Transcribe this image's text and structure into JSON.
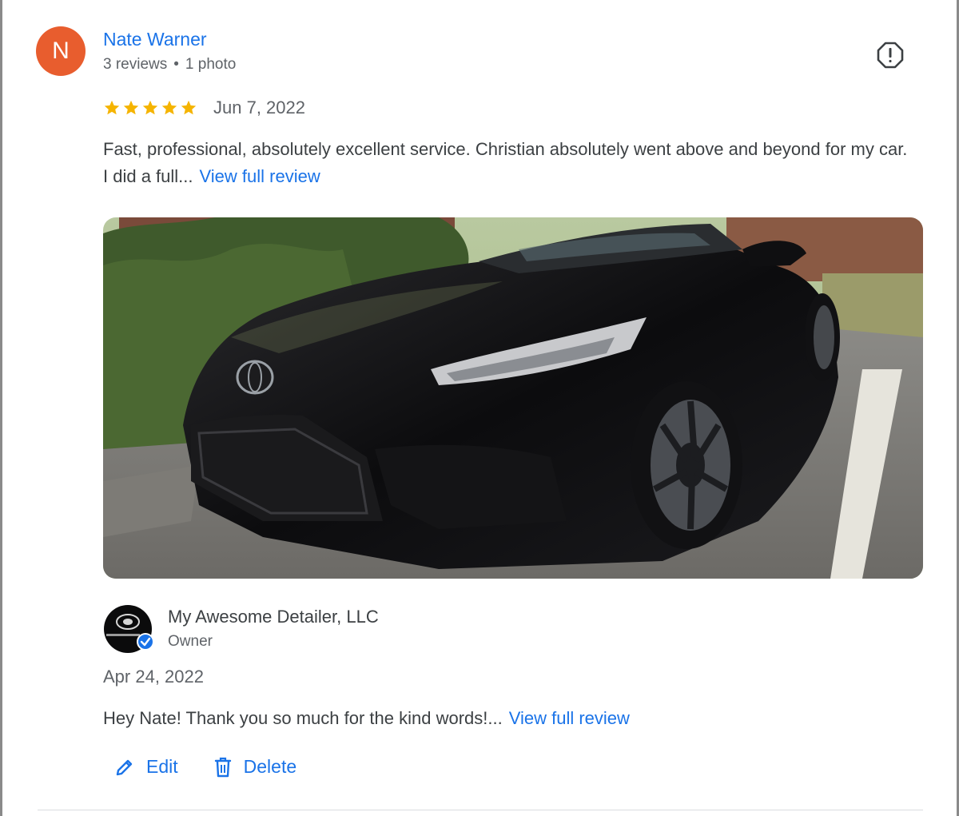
{
  "reviewer": {
    "initial": "N",
    "name": "Nate Warner",
    "reviews_count": "3 reviews",
    "separator": "•",
    "photos_count": "1 photo",
    "avatar_color": "#e85d2e"
  },
  "review": {
    "rating": 5,
    "date": "Jun 7, 2022",
    "text": "Fast, professional, absolutely excellent service. Christian absolutely went above and beyond for my car. I did a full...",
    "view_full_label": "View full review",
    "photo_icon": "photo-black-car"
  },
  "owner_response": {
    "business_name": "My Awesome Detailer, LLC",
    "role": "Owner",
    "date": "Apr 24, 2022",
    "text": "Hey Nate! Thank you so much for the kind words!...",
    "view_full_label": "View full review",
    "badge_icon": "verified-check-icon"
  },
  "actions": {
    "edit_label": "Edit",
    "delete_label": "Delete"
  },
  "colors": {
    "link": "#1a73e8",
    "star": "#f5b400",
    "text": "#3c4043",
    "secondary": "#5f6368"
  }
}
